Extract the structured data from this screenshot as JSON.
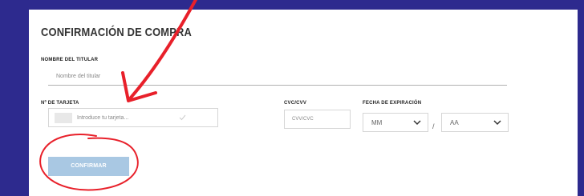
{
  "form": {
    "title": "CONFIRMACIÓN DE COMPRA",
    "holder_label": "NOMBRE DEL TITULAR",
    "holder_placeholder": "Nombre del titular",
    "card_label": "Nº DE TARJETA",
    "card_placeholder": "Introduce tu tarjeta...",
    "cvc_label": "CVC/CVV",
    "cvc_placeholder": "CVV/CVC",
    "expiry_label": "FECHA DE EXPIRACIÓN",
    "month_value": "MM",
    "year_value": "AA",
    "separator": "/",
    "confirm_label": "CONFIRMAR"
  },
  "colors": {
    "background": "#2d2a8e",
    "annotation": "#e8202a",
    "button": "#a9c8e3"
  },
  "icons": [
    "check-icon",
    "chevron-down-icon",
    "arrow-annotation",
    "circle-annotation"
  ]
}
